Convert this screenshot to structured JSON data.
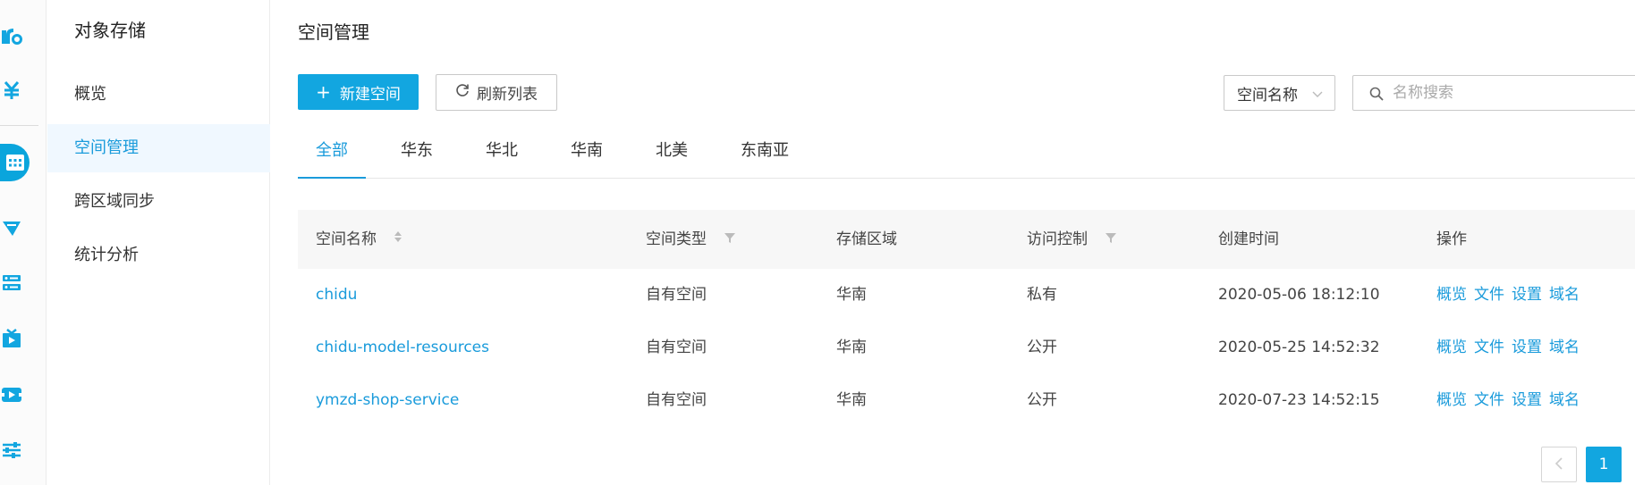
{
  "submenu": {
    "title": "对象存储",
    "items": [
      {
        "label": "概览",
        "active": false
      },
      {
        "label": "空间管理",
        "active": true
      },
      {
        "label": "跨区域同步",
        "active": false
      },
      {
        "label": "统计分析",
        "active": false
      }
    ]
  },
  "page": {
    "title": "空间管理"
  },
  "toolbar": {
    "create_label": "新建空间",
    "refresh_label": "刷新列表",
    "search_field_select": "空间名称",
    "search_placeholder": "名称搜索"
  },
  "tabs": [
    {
      "label": "全部",
      "active": true
    },
    {
      "label": "华东",
      "active": false
    },
    {
      "label": "华北",
      "active": false
    },
    {
      "label": "华南",
      "active": false
    },
    {
      "label": "北美",
      "active": false
    },
    {
      "label": "东南亚",
      "active": false
    }
  ],
  "table": {
    "columns": [
      "空间名称",
      "空间类型",
      "存储区域",
      "访问控制",
      "创建时间",
      "操作"
    ],
    "rows": [
      {
        "name": "chidu",
        "type": "自有空间",
        "region": "华南",
        "access": "私有",
        "created": "2020-05-06 18:12:10"
      },
      {
        "name": "chidu-model-resources",
        "type": "自有空间",
        "region": "华南",
        "access": "公开",
        "created": "2020-05-25 14:52:32"
      },
      {
        "name": "ymzd-shop-service",
        "type": "自有空间",
        "region": "华南",
        "access": "公开",
        "created": "2020-07-23 14:52:15"
      }
    ],
    "actions": [
      "概览",
      "文件",
      "设置",
      "域名"
    ]
  },
  "pagination": {
    "current_page": "1"
  },
  "colors": {
    "accent": "#12a6e0",
    "link": "#1a9bdb",
    "header_bg": "#f7f7f7",
    "active_menu_bg": "#f0f8ff"
  },
  "icons": {
    "rail": [
      "logo-icon",
      "billing-yen-icon",
      "storage-grid-icon",
      "cdn-funnel-icon",
      "server-icon",
      "media-play-icon",
      "video-icon",
      "settings-sliders-icon"
    ]
  }
}
